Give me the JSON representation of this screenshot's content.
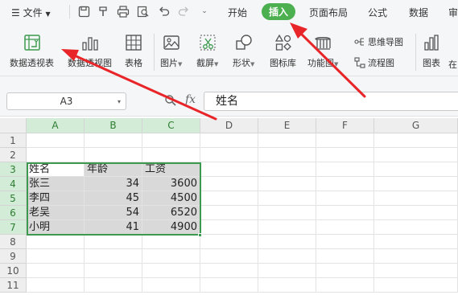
{
  "menubar": {
    "file_label": "文件",
    "tabs": [
      {
        "label": "开始"
      },
      {
        "label": "插入",
        "active": true
      },
      {
        "label": "页面布局"
      },
      {
        "label": "公式"
      },
      {
        "label": "数据"
      },
      {
        "label": "审"
      }
    ]
  },
  "ribbon": {
    "pivot_table": "数据透视表",
    "pivot_chart": "数据透视图",
    "table": "表格",
    "picture": "图片",
    "screenshot": "截屏",
    "shapes": "形状",
    "icon_library": "图标库",
    "function_chart": "功能图",
    "mind_map": "思维导图",
    "flowchart": "流程图",
    "chart": "图表",
    "more": "在"
  },
  "formula_bar": {
    "name_box": "A3",
    "fx_label": "fx",
    "formula": "姓名"
  },
  "sheet": {
    "columns": [
      "A",
      "B",
      "C",
      "D",
      "E",
      "F",
      "G"
    ],
    "rows": [
      "1",
      "2",
      "3",
      "4",
      "5",
      "6",
      "7",
      "8",
      "9",
      "10",
      "11"
    ],
    "data": [
      [
        "姓名",
        "年龄",
        "工资"
      ],
      [
        "张三",
        "34",
        "3600"
      ],
      [
        "李四",
        "45",
        "4500"
      ],
      [
        "老吴",
        "54",
        "6520"
      ],
      [
        "小明",
        "41",
        "4900"
      ]
    ]
  },
  "colors": {
    "accent": "#4caf50",
    "selection_border": "#3c9a4e",
    "annotation_arrow": "#e8262a"
  }
}
